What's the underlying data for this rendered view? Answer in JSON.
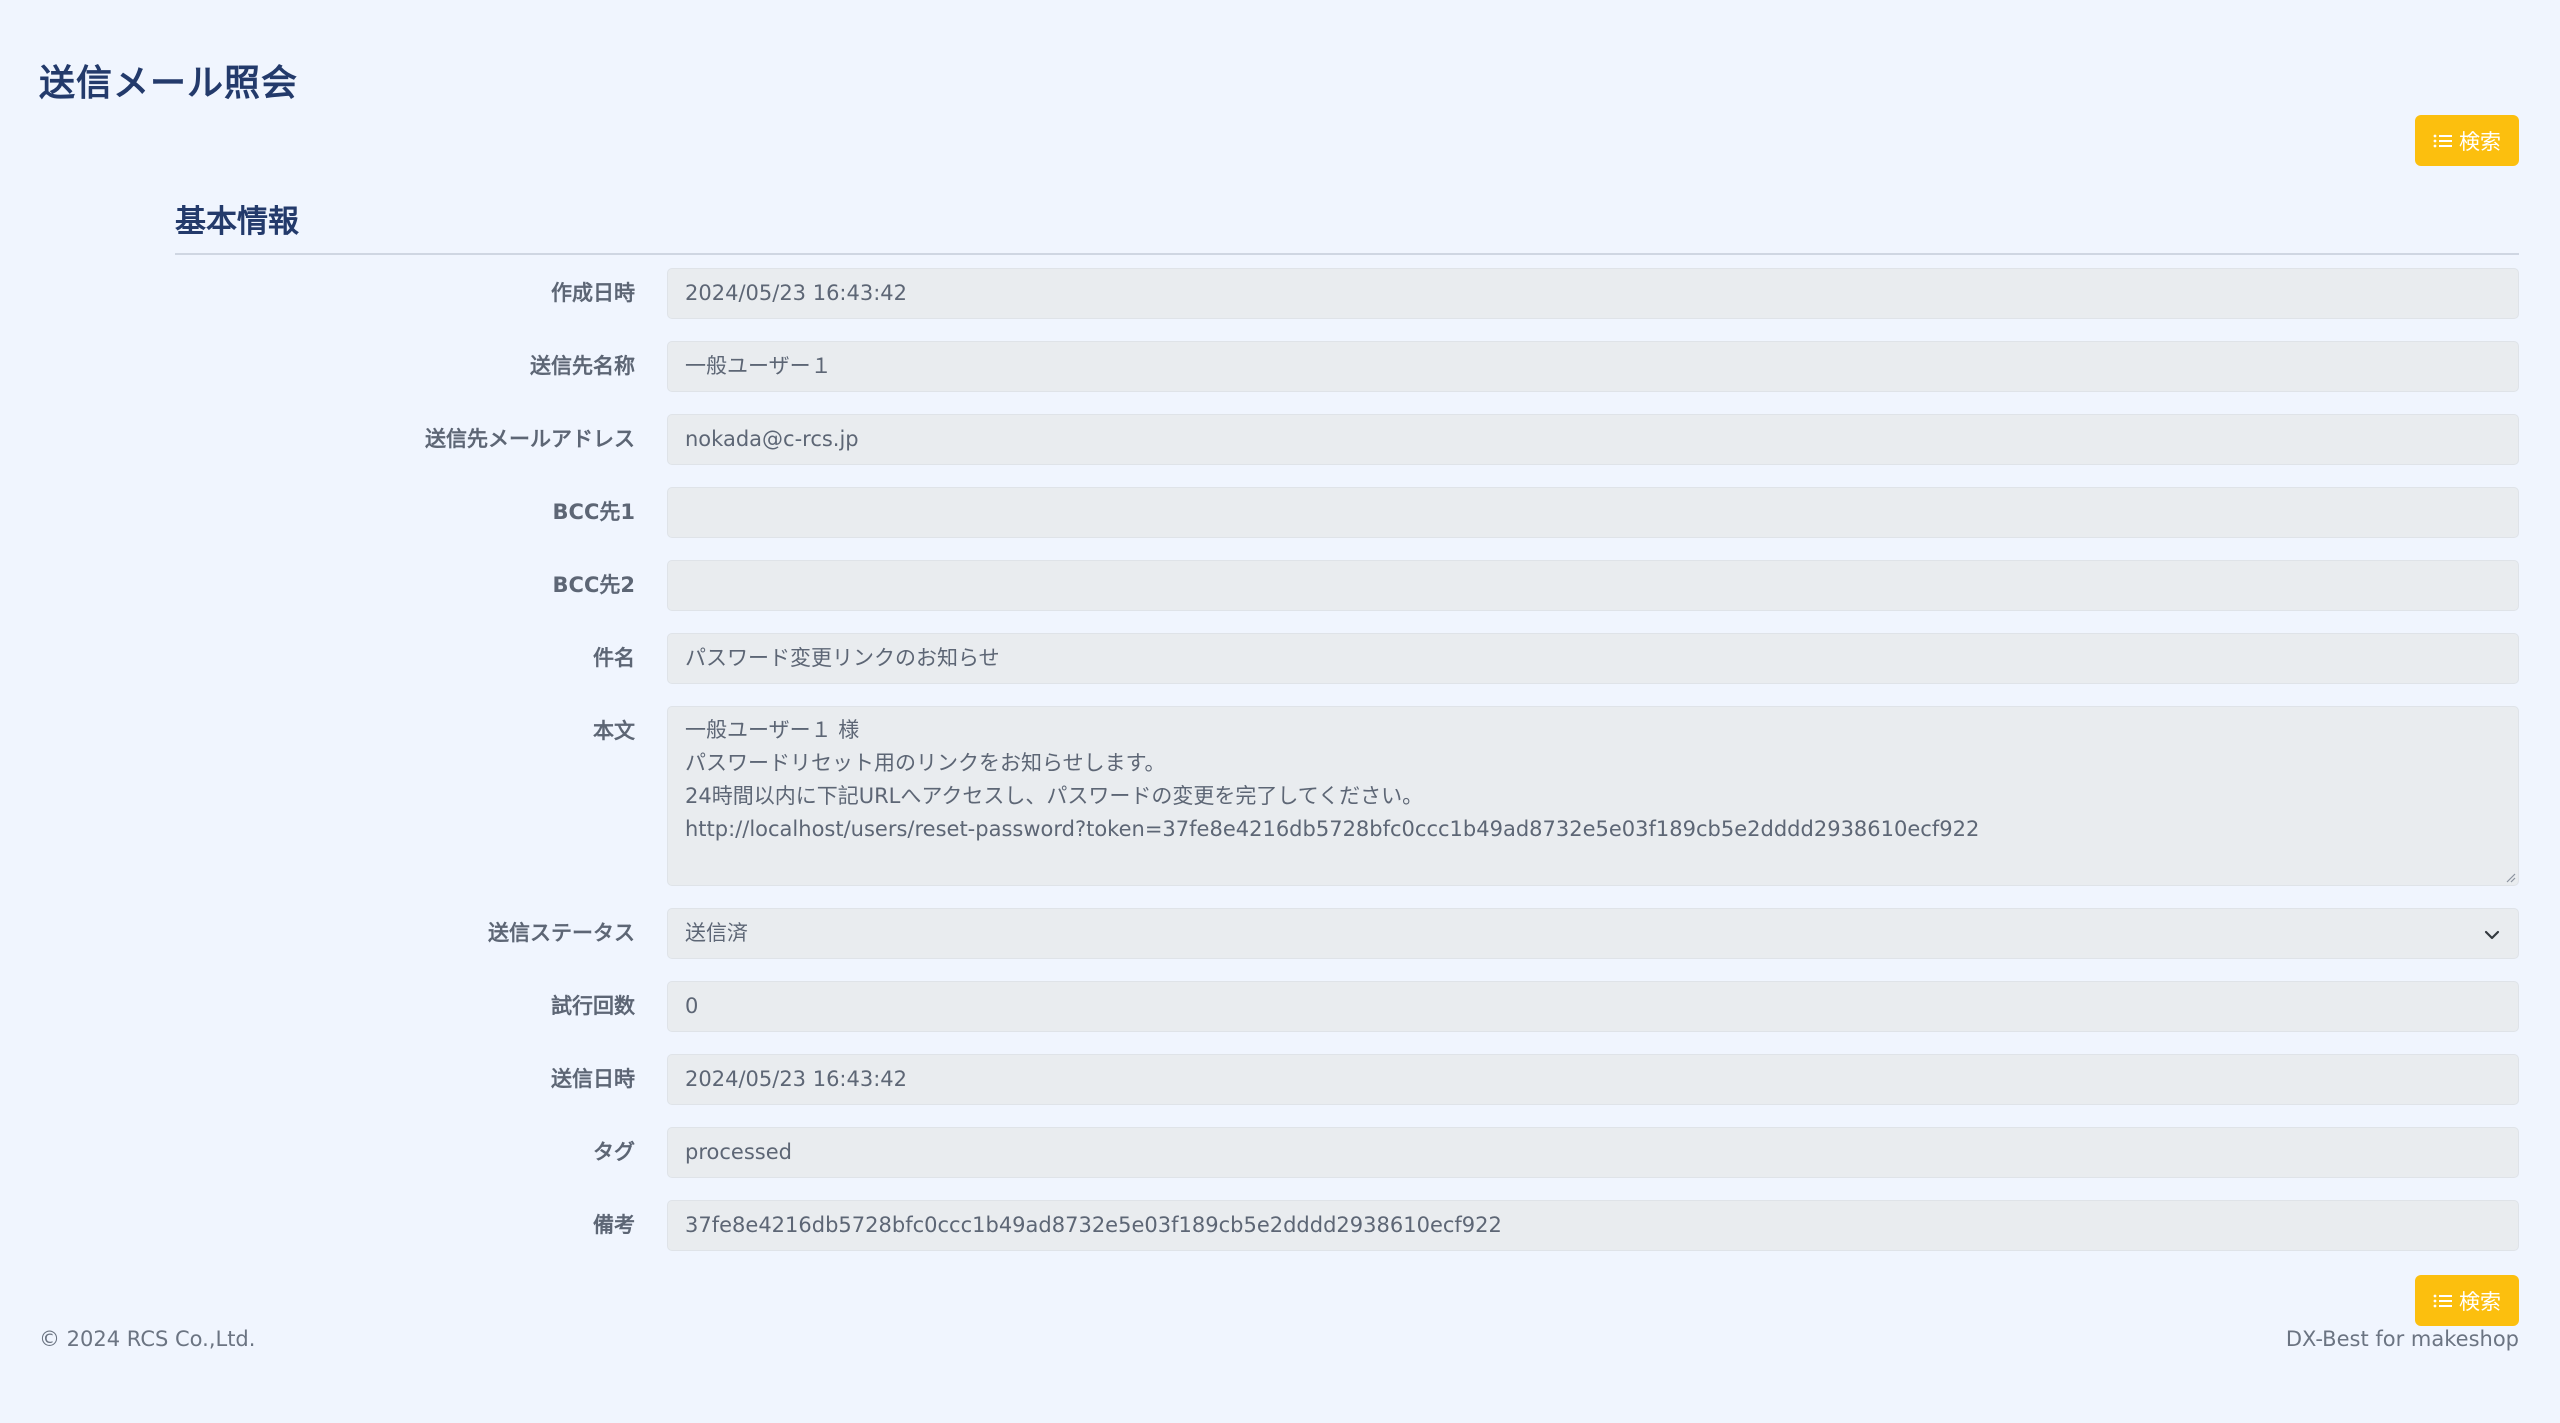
{
  "page": {
    "title": "送信メール照会",
    "search_button_label": "検索"
  },
  "section": {
    "title": "基本情報"
  },
  "fields": {
    "created_at": {
      "label": "作成日時",
      "value": "2024/05/23 16:43:42"
    },
    "recipient_name": {
      "label": "送信先名称",
      "value": "一般ユーザー１"
    },
    "recipient_email": {
      "label": "送信先メールアドレス",
      "value": "nokada@c-rcs.jp"
    },
    "bcc1": {
      "label": "BCC先1",
      "value": ""
    },
    "bcc2": {
      "label": "BCC先2",
      "value": ""
    },
    "subject": {
      "label": "件名",
      "value": "パスワード変更リンクのお知らせ"
    },
    "body": {
      "label": "本文",
      "lines": [
        "一般ユーザー１ 様",
        "パスワードリセット用のリンクをお知らせします。",
        "24時間以内に下記URLへアクセスし、パスワードの変更を完了してください。",
        "http://localhost/users/reset-password?token=37fe8e4216db5728bfc0ccc1b49ad8732e5e03f189cb5e2dddd2938610ecf922"
      ]
    },
    "send_status": {
      "label": "送信ステータス",
      "value": "送信済"
    },
    "attempts": {
      "label": "試行回数",
      "value": "0"
    },
    "sent_at": {
      "label": "送信日時",
      "value": "2024/05/23 16:43:42"
    },
    "tag": {
      "label": "タグ",
      "value": "processed"
    },
    "note": {
      "label": "備考",
      "value": "37fe8e4216db5728bfc0ccc1b49ad8732e5e03f189cb5e2dddd2938610ecf922"
    }
  },
  "footer": {
    "copyright": "© 2024 RCS Co.,Ltd.",
    "product": "DX-Best for makeshop"
  },
  "colors": {
    "background": "#f0f5fe",
    "accent": "#fcbf0e",
    "heading": "#233a6b",
    "field_background": "#e9ecef"
  }
}
